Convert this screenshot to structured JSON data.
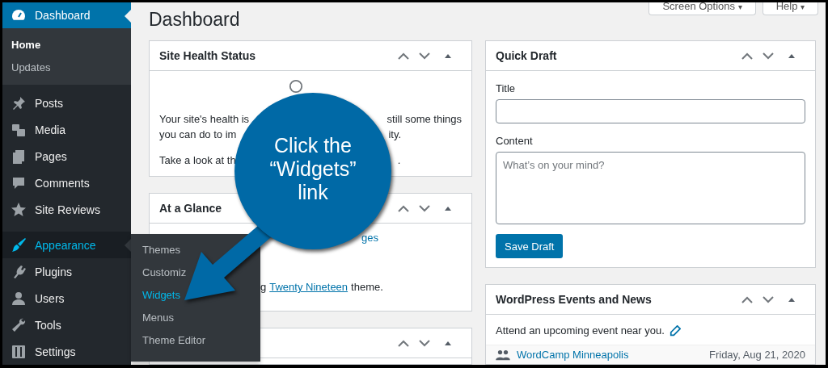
{
  "sidebar": {
    "items": [
      {
        "label": "Dashboard",
        "current": true,
        "hovered": false,
        "children": [
          {
            "label": "Home",
            "selected": true
          },
          {
            "label": "Updates",
            "selected": false
          }
        ]
      },
      {
        "label": "Posts",
        "current": false,
        "hovered": false
      },
      {
        "label": "Media",
        "current": false,
        "hovered": false
      },
      {
        "label": "Pages",
        "current": false,
        "hovered": false
      },
      {
        "label": "Comments",
        "current": false,
        "hovered": false
      },
      {
        "label": "Site Reviews",
        "current": false,
        "hovered": false
      },
      {
        "label": "Appearance",
        "current": false,
        "hovered": true,
        "children": [
          {
            "label": "Themes",
            "selected": false
          },
          {
            "label": "Customiz",
            "selected": false
          },
          {
            "label": "Widgets",
            "selected": true
          },
          {
            "label": "Menus",
            "selected": false
          },
          {
            "label": "Theme Editor",
            "selected": false
          }
        ]
      },
      {
        "label": "Plugins",
        "current": false,
        "hovered": false
      },
      {
        "label": "Users",
        "current": false,
        "hovered": false
      },
      {
        "label": "Tools",
        "current": false,
        "hovered": false
      },
      {
        "label": "Settings",
        "current": false,
        "hovered": false
      }
    ]
  },
  "page_title": "Dashboard",
  "top_buttons": [
    {
      "label": "Screen Options",
      "caret": "▾"
    },
    {
      "label": "Help",
      "caret": "▾"
    }
  ],
  "site_health": {
    "title": "Site Health Status",
    "lines": [
      [
        "Your site's health is",
        "still some things"
      ],
      [
        "you can do to im",
        "ity."
      ],
      [
        "Take a look at th",
        "."
      ]
    ]
  },
  "at_a_glance": {
    "title": "At a Glance",
    "pages_link": "ges",
    "theme_prefix": "g",
    "theme_link": "Twenty Nineteen",
    "theme_suffix": "theme."
  },
  "quick_draft": {
    "title": "Quick Draft",
    "title_label": "Title",
    "content_label": "Content",
    "content_placeholder": "What’s on your mind?",
    "save_button": "Save Draft"
  },
  "events": {
    "title": "WordPress Events and News",
    "intro": "Attend an upcoming event near you.",
    "event_name": "WordCamp Minneapolis",
    "event_date": "Friday, Aug 21, 2020"
  },
  "callout": {
    "lines": [
      "Click the",
      "“Widgets”",
      "link"
    ]
  }
}
